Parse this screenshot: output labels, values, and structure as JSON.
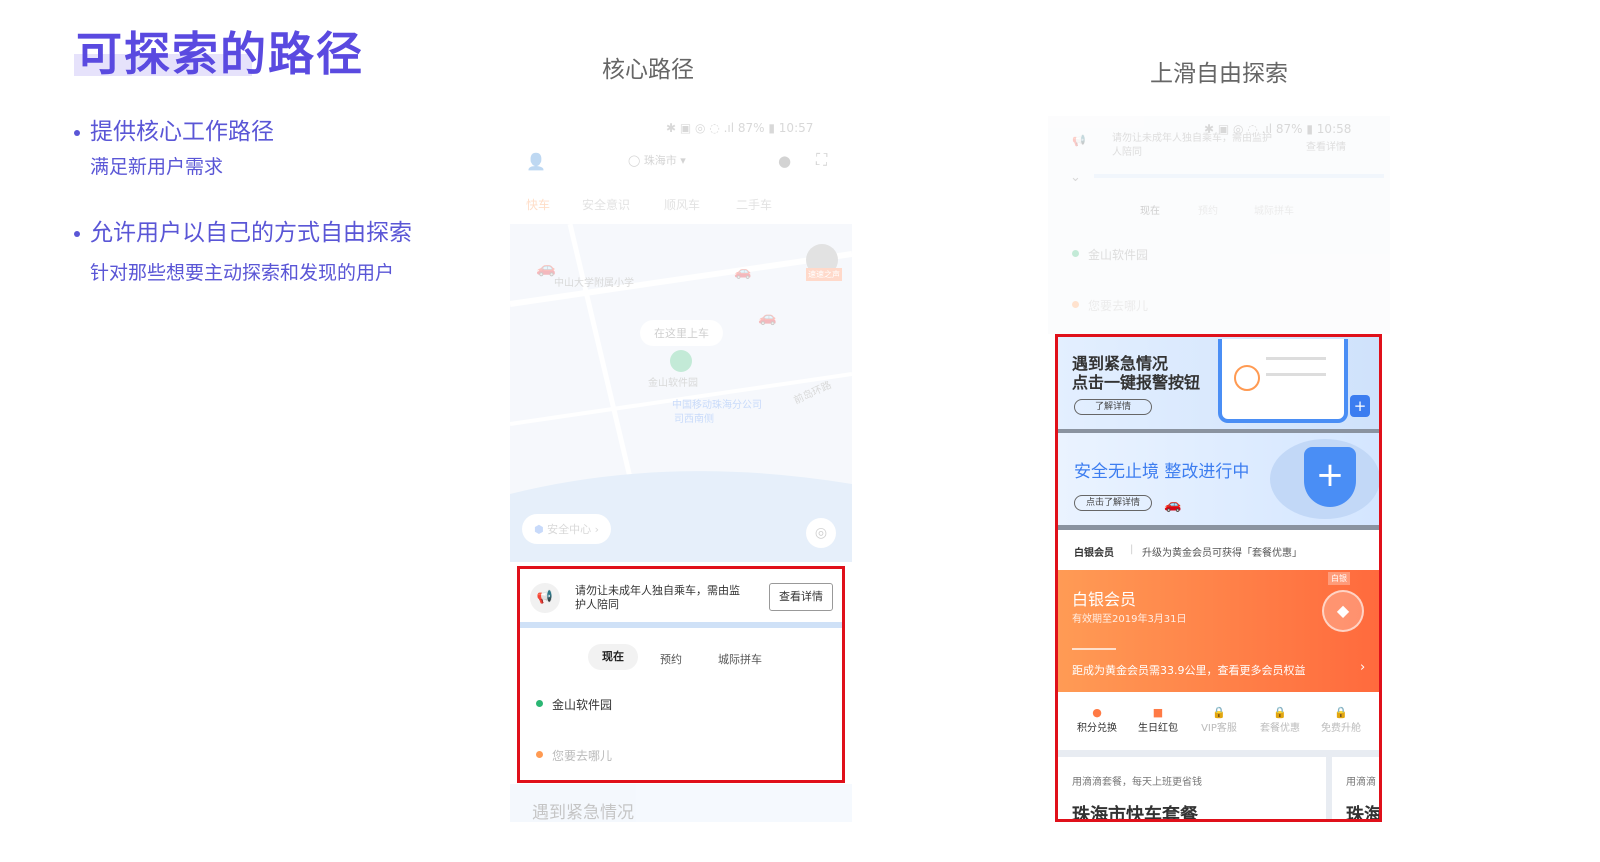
{
  "slide": {
    "title": "可探索的路径",
    "bullets": [
      {
        "text": "提供核心工作路径",
        "sub": "满足新用户需求"
      },
      {
        "text": "允许用户以自己的方式自由探索",
        "sub": "针对那些想要主动探索和发现的用户"
      }
    ]
  },
  "columns": {
    "core": "核心路径",
    "explore": "上滑自由探索"
  },
  "phone1": {
    "status": {
      "battery": "87%",
      "time": "10:57"
    },
    "city": "珠海市",
    "tabs": [
      "快车",
      "安全意识",
      "顺风车",
      "二手车"
    ],
    "map_labels": {
      "school": "中山大学附属小学",
      "board_here": "在这里上车",
      "poi1": "金山软件园",
      "poi2": "中国移动珠海分公司",
      "poi2_line2": "司西南侧",
      "road": "前岛环路",
      "badge": "速速之声"
    },
    "safety_center": "安全中心",
    "notice": "请勿让未成年人独自乘车，需由监护人陪同",
    "notice_button": "查看详情",
    "ride_tabs": [
      "现在",
      "预约",
      "城际拼车"
    ],
    "from": "金山软件园",
    "to_placeholder": "您要去哪儿",
    "peek_text": "遇到紧急情况"
  },
  "phone2": {
    "status": {
      "battery": "87%",
      "time": "10:58"
    },
    "notice": "请勿让未成年人独自乘车，需由监护人陪同",
    "notice_button": "查看详情",
    "ride_tabs": [
      "现在",
      "预约",
      "城际拼车"
    ],
    "from": "金山软件园",
    "to_placeholder": "您要去哪儿",
    "card1": {
      "line1": "遇到紧急情况",
      "line2": "点击一键报警按钮",
      "button": "了解详情"
    },
    "card2": {
      "title": "安全无止境 整改进行中",
      "button": "点击了解详情"
    },
    "member": {
      "label": "白银会员",
      "upgrade": "升级为黄金会员可获得「套餐优惠」",
      "tier": "白银会员",
      "expiry": "有效期至2019年3月31日",
      "progress": "距成为黄金会员需33.9公里，查看更多会员权益",
      "badge": "白银"
    },
    "perks": [
      {
        "label": "积分兑换",
        "locked": false
      },
      {
        "label": "生日红包",
        "locked": false
      },
      {
        "label": "VIP客服",
        "locked": true
      },
      {
        "label": "套餐优惠",
        "locked": true
      },
      {
        "label": "免费升舱",
        "locked": true
      }
    ],
    "package": {
      "caption": "用滴滴套餐，每天上班更省钱",
      "title": "珠海市快车套餐",
      "caption2": "用滴滴",
      "title2": "珠海"
    }
  },
  "colors": {
    "accent": "#5a4ae0",
    "highlight": "#e0101a",
    "orange": "#ff7a45",
    "blue": "#3c7df0"
  }
}
